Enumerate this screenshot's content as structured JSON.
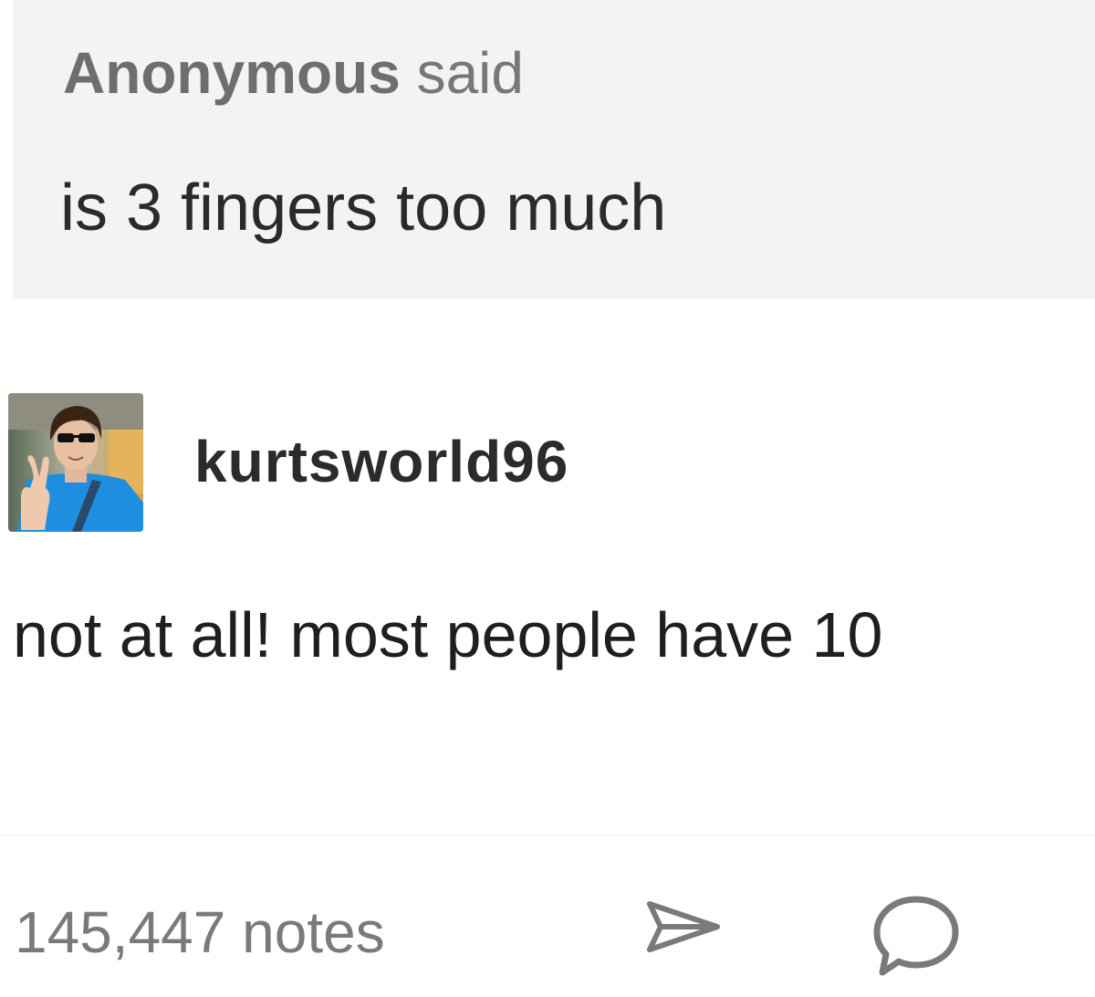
{
  "ask": {
    "asker": "Anonymous",
    "said": " said",
    "question": "is 3 fingers too much"
  },
  "answer": {
    "username": "kurtsworld96",
    "avatar_icon": "user-avatar-photo",
    "text": "not at all! most people have 10"
  },
  "footer": {
    "notes": "145,447 notes",
    "share_icon": "share-arrow-icon",
    "reply_icon": "speech-bubble-icon"
  },
  "colors": {
    "ask_background": "#f3f3f3",
    "text_dark": "#1f1f1f",
    "text_muted": "#7a7a7a"
  }
}
